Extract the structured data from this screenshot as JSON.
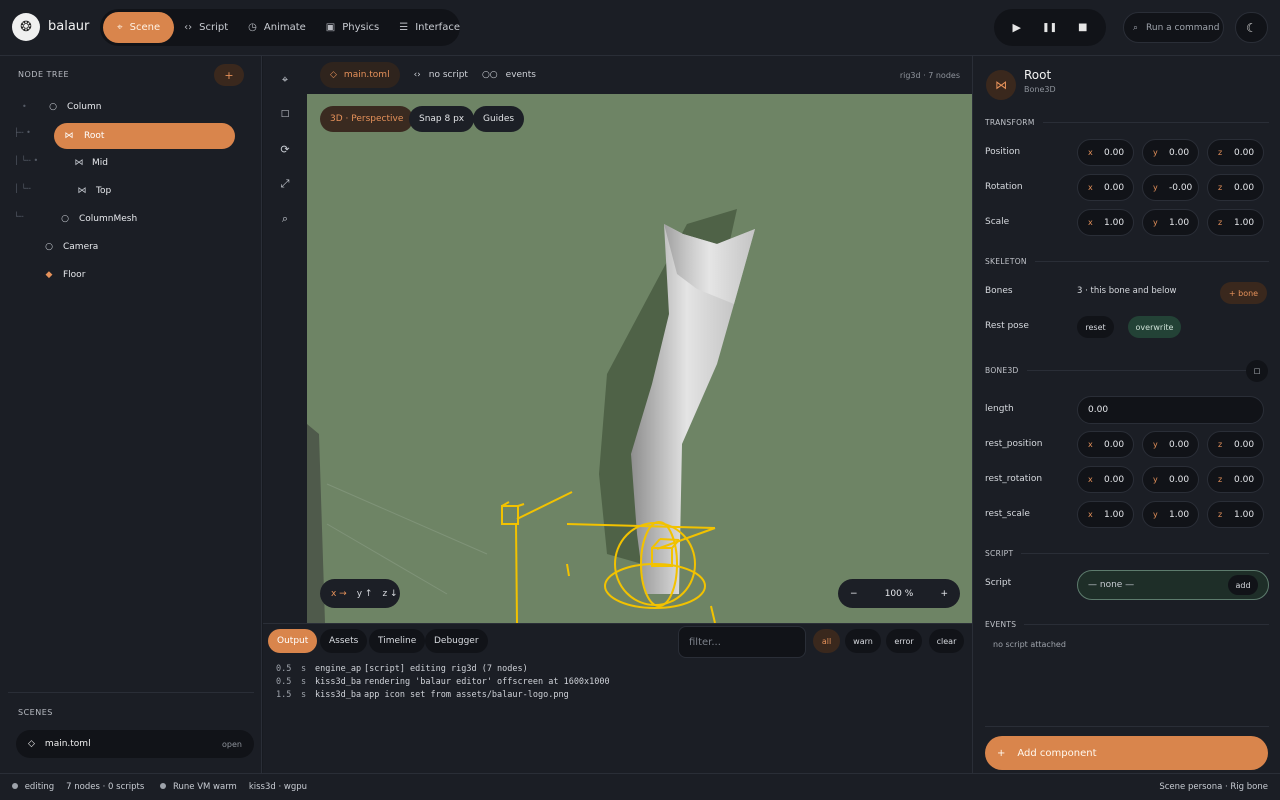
{
  "app": {
    "name": "balaur"
  },
  "modes": [
    {
      "label": "Scene",
      "icon": "⌖"
    },
    {
      "label": "Script",
      "icon": "‹›"
    },
    {
      "label": "Animate",
      "icon": "◷"
    },
    {
      "label": "Physics",
      "icon": "▣"
    },
    {
      "label": "Interface",
      "icon": "☰"
    }
  ],
  "transport": {
    "play": "▶",
    "pause": "❚❚",
    "stop": "■"
  },
  "command": {
    "placeholder": "Run a command"
  },
  "tree": {
    "title": "NODE TREE",
    "add": "+",
    "nodes": [
      {
        "label": "Column",
        "icon": "○"
      },
      {
        "label": "Root",
        "icon": "⋈"
      },
      {
        "label": "Mid",
        "icon": "⋈"
      },
      {
        "label": "Top",
        "icon": "⋈"
      },
      {
        "label": "ColumnMesh",
        "icon": "○"
      },
      {
        "label": "Camera",
        "icon": "○"
      },
      {
        "label": "Floor",
        "icon": "◆"
      }
    ]
  },
  "scenes": {
    "title": "SCENES",
    "items": [
      {
        "label": "main.toml",
        "action": "open"
      }
    ]
  },
  "editor_head": {
    "file": "main.toml",
    "script": "no script",
    "events": "events",
    "summary": "rig3d · 7 nodes"
  },
  "viewport": {
    "projection": "3D · Perspective",
    "snap": "Snap 8 px",
    "guides": "Guides",
    "axes": {
      "x": "x →",
      "y": "y ↑",
      "z": "z ↓"
    },
    "zoom": {
      "minus": "−",
      "value": "100 %",
      "plus": "+"
    }
  },
  "console": {
    "tabs": [
      "Output",
      "Assets",
      "Timeline",
      "Debugger"
    ],
    "filter_placeholder": "filter...",
    "levels": [
      "all",
      "warn",
      "error",
      "clear"
    ],
    "logs": [
      {
        "time": "0.5",
        "unit": "s",
        "source": "engine_ap",
        "message": "[script] editing rig3d (7 nodes)"
      },
      {
        "time": "0.5",
        "unit": "s",
        "source": "kiss3d_ba",
        "message": "rendering 'balaur editor' offscreen at 1600x1000"
      },
      {
        "time": "1.5",
        "unit": "s",
        "source": "kiss3d_ba",
        "message": "app icon set from assets/balaur-logo.png"
      }
    ]
  },
  "inspector": {
    "name": "Root",
    "type": "Bone3D",
    "transform_title": "TRANSFORM",
    "transform": [
      {
        "label": "Position",
        "x": "0.00",
        "y": "0.00",
        "z": "0.00"
      },
      {
        "label": "Rotation",
        "x": "0.00",
        "y": "-0.00",
        "z": "0.00"
      },
      {
        "label": "Scale",
        "x": "1.00",
        "y": "1.00",
        "z": "1.00"
      }
    ],
    "skeleton_title": "SKELETON",
    "bones_label": "Bones",
    "bones_value": "3 · this bone and below",
    "bones_add": "+ bone",
    "rest_pose_label": "Rest pose",
    "reset": "reset",
    "overwrite": "overwrite",
    "bone3d_title": "BONE3D",
    "bone3d_toggle": "□",
    "length_label": "length",
    "length_value": "0.00",
    "bone_props": [
      {
        "label": "rest_position",
        "x": "0.00",
        "y": "0.00",
        "z": "0.00"
      },
      {
        "label": "rest_rotation",
        "x": "0.00",
        "y": "0.00",
        "z": "0.00"
      },
      {
        "label": "rest_scale",
        "x": "1.00",
        "y": "1.00",
        "z": "1.00"
      }
    ],
    "script_title": "SCRIPT",
    "script_label": "Script",
    "script_value": "— none —",
    "script_add": "add",
    "events_title": "EVENTS",
    "events_empty": "no script attached",
    "add_component": "Add component"
  },
  "status": {
    "mode": "editing",
    "counts": "7 nodes · 0 scripts",
    "vm": "Rune VM warm",
    "backend": "kiss3d · wgpu",
    "persona": "Scene persona · Rig bone"
  },
  "colors": {
    "accent": "#d9854c",
    "viewport": "#6e8465",
    "gizmo": "#f2c200"
  }
}
